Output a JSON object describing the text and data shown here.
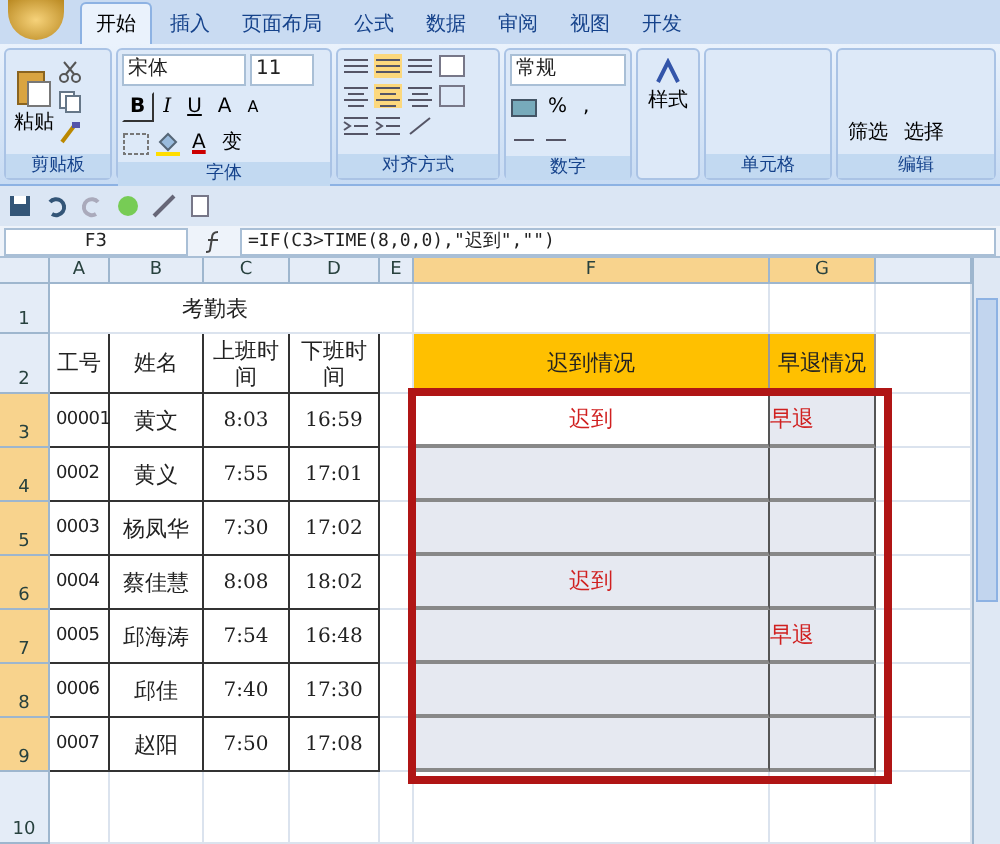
{
  "ribbon": {
    "tabs": [
      {
        "label": "开始",
        "selected": true
      },
      {
        "label": "插入",
        "selected": false
      },
      {
        "label": "页面布局",
        "selected": false
      },
      {
        "label": "公式",
        "selected": false
      },
      {
        "label": "数据",
        "selected": false
      },
      {
        "label": "审阅",
        "selected": false
      },
      {
        "label": "视图",
        "selected": false
      },
      {
        "label": "开发",
        "selected": false
      }
    ],
    "clipboard": {
      "paste": "粘贴",
      "label": "剪贴板"
    },
    "font": {
      "family": "宋体",
      "size": "11",
      "bold": "B",
      "italic": "I",
      "underline": "U",
      "grow": "A",
      "shrink": "A",
      "font_color": "A",
      "phonetic": "变",
      "label": "字体"
    },
    "alignment": {
      "label": "对齐方式"
    },
    "number": {
      "format": "常规",
      "percent": "%",
      "comma": ",",
      "label": "数字"
    },
    "styles": {
      "button": "样式"
    },
    "cells": {
      "label": "单元格"
    },
    "editing": {
      "filter": "筛选",
      "select": "选择",
      "label": "编辑"
    }
  },
  "formula_bar": {
    "name_box": "F3",
    "formula": "=IF(C3>TIME(8,0,0),\"迟到\",\"\")"
  },
  "sheet": {
    "columns": [
      {
        "label": "A",
        "selected": false
      },
      {
        "label": "B",
        "selected": false
      },
      {
        "label": "C",
        "selected": false
      },
      {
        "label": "D",
        "selected": false
      },
      {
        "label": "E",
        "selected": false
      },
      {
        "label": "F",
        "selected": true
      },
      {
        "label": "G",
        "selected": true
      }
    ],
    "title": "考勤表",
    "headers": [
      "工号",
      "姓名",
      "上班时间",
      "下班时间"
    ],
    "status_headers": [
      "迟到情况",
      "早退情况"
    ],
    "rows": [
      {
        "number": "3",
        "selected": true,
        "id": "00001",
        "name": "黄文",
        "start": "8:03",
        "end": "16:59",
        "late": "迟到",
        "early": "早退",
        "active": true
      },
      {
        "number": "4",
        "selected": true,
        "id": "0002",
        "name": "黄义",
        "start": "7:55",
        "end": "17:01",
        "active": false
      },
      {
        "number": "5",
        "selected": true,
        "id": "0003",
        "name": "杨凤华",
        "start": "7:30",
        "end": "17:02",
        "active": false
      },
      {
        "number": "6",
        "selected": true,
        "id": "0004",
        "name": "蔡佳慧",
        "start": "8:08",
        "end": "18:02",
        "late": "迟到",
        "active": false
      },
      {
        "number": "7",
        "selected": true,
        "id": "0005",
        "name": "邱海涛",
        "start": "7:54",
        "end": "16:48",
        "early": "早退",
        "active": false
      },
      {
        "number": "8",
        "selected": true,
        "id": "0006",
        "name": "邱佳",
        "start": "7:40",
        "end": "17:30",
        "active": false
      },
      {
        "number": "9",
        "selected": true,
        "id": "0007",
        "name": "赵阳",
        "start": "7:50",
        "end": "17:08",
        "active": false
      }
    ],
    "row_numbers": [
      "1",
      "2",
      "10"
    ]
  }
}
